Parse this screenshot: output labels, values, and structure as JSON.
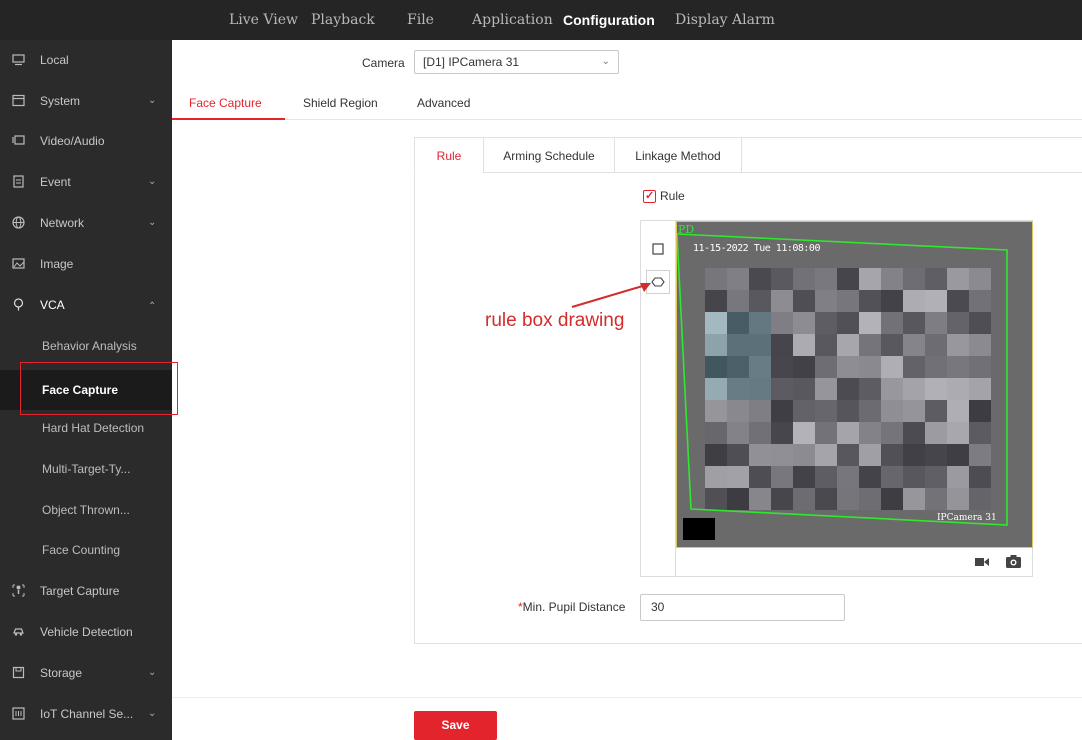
{
  "topnav": {
    "items": [
      "Live View",
      "Playback",
      "File",
      "Application",
      "Configuration",
      "Display Alarm"
    ],
    "active": "Configuration"
  },
  "sidebar": {
    "items": [
      {
        "label": "Local",
        "icon": "monitor-icon",
        "expandable": false
      },
      {
        "label": "System",
        "icon": "system-icon",
        "expandable": true
      },
      {
        "label": "Video/Audio",
        "icon": "video-audio-icon",
        "expandable": false
      },
      {
        "label": "Event",
        "icon": "event-icon",
        "expandable": true
      },
      {
        "label": "Network",
        "icon": "network-icon",
        "expandable": true
      },
      {
        "label": "Image",
        "icon": "image-icon",
        "expandable": false
      },
      {
        "label": "VCA",
        "icon": "vca-icon",
        "expandable": true,
        "expanded": true
      }
    ],
    "vca_sub": [
      "Behavior Analysis",
      "Face Capture",
      "Hard Hat Detection",
      "Multi-Target-Ty...",
      "Object Thrown...",
      "Face Counting"
    ],
    "vca_active": "Face Capture",
    "items_after": [
      {
        "label": "Target Capture",
        "icon": "target-capture-icon",
        "expandable": false
      },
      {
        "label": "Vehicle Detection",
        "icon": "vehicle-icon",
        "expandable": false
      },
      {
        "label": "Storage",
        "icon": "storage-icon",
        "expandable": true
      },
      {
        "label": "IoT Channel Se...",
        "icon": "iot-icon",
        "expandable": true
      }
    ]
  },
  "camera": {
    "label": "Camera",
    "value": "[D1] IPCamera 31"
  },
  "tabs": {
    "items": [
      "Face Capture",
      "Shield Region",
      "Advanced"
    ],
    "active": "Face Capture"
  },
  "inner_tabs": {
    "items": [
      "Rule",
      "Arming Schedule",
      "Linkage Method"
    ],
    "active": "Rule"
  },
  "rule": {
    "label": "Rule",
    "checked": true
  },
  "video": {
    "osd_date": "11-15-2022 Tue 11:08:00",
    "osd_camera": "IPCamera 31",
    "osd_corner": "PD"
  },
  "annotation": {
    "text": "rule box drawing"
  },
  "pupil": {
    "required_mark": "*",
    "label": "Min. Pupil Distance",
    "value": "30"
  },
  "save_label": "Save",
  "colors": {
    "accent": "#e4242c",
    "sidebar": "#2b2b2b",
    "topbar": "#252525",
    "rule_box": "#2ee82e"
  }
}
